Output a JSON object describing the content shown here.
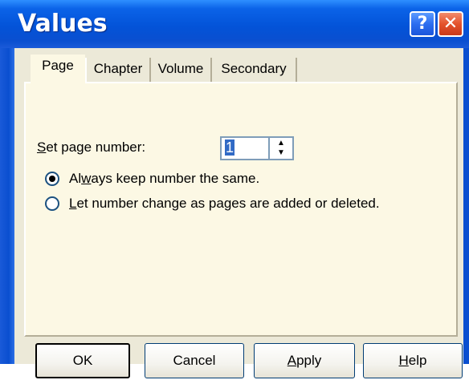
{
  "window": {
    "title": "Values",
    "help_glyph": "?",
    "close_glyph": "✕"
  },
  "tabs": [
    {
      "label": "Page",
      "active": true
    },
    {
      "label": "Chapter",
      "active": false
    },
    {
      "label": "Volume",
      "active": false
    },
    {
      "label": "Secondary",
      "active": false
    }
  ],
  "page_tab": {
    "set_page_label_prefix": "S",
    "set_page_label_rest": "et page number:",
    "page_number": "1",
    "options": [
      {
        "label_pre": "Al",
        "label_u": "w",
        "label_post": "ays keep number the same.",
        "selected": true
      },
      {
        "label_pre": "",
        "label_u": "L",
        "label_post": "et number change as pages are added or deleted.",
        "selected": false
      }
    ]
  },
  "buttons": {
    "ok": "OK",
    "cancel": "Cancel",
    "apply_u": "A",
    "apply_rest": "pply",
    "help_u": "H",
    "help_rest": "elp"
  },
  "icons": {
    "spin_up": "▲",
    "spin_down": "▼"
  },
  "colors": {
    "titlebar": "#0353d8",
    "dialog_bg": "#ece9d8",
    "panel_bg": "#fcf8e4",
    "selection": "#316ac5"
  }
}
